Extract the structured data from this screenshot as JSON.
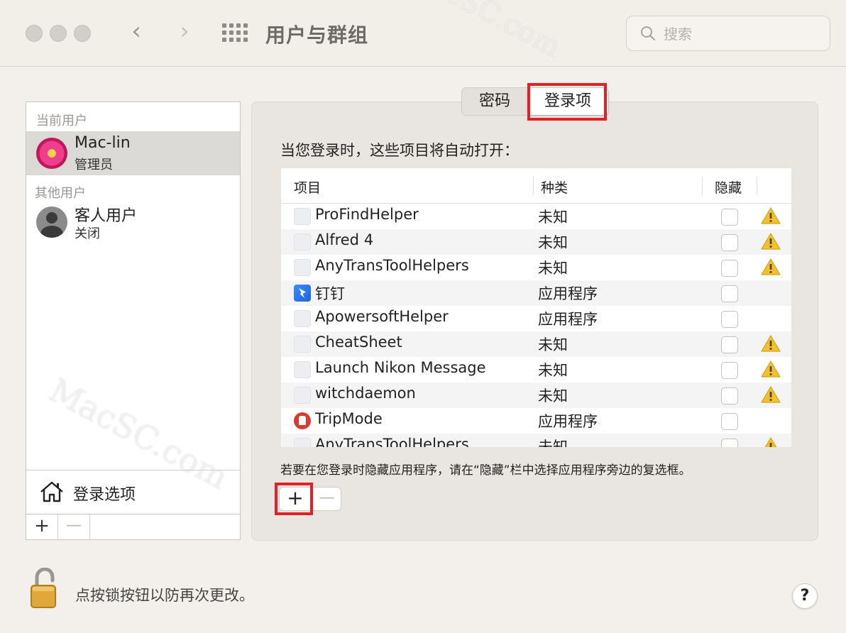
{
  "window": {
    "title": "用户与群组",
    "search_placeholder": "搜索",
    "back_label": "‹",
    "forward_label": "›"
  },
  "watermark": "MacSC.com",
  "users_panel": {
    "current_section": "当前用户",
    "current_user": {
      "name": "Mac-lin",
      "role": "管理员",
      "avatar": "flower-avatar"
    },
    "other_section": "其他用户",
    "other_user": {
      "name": "客人用户",
      "role": "关闭",
      "avatar": "guest-avatar"
    },
    "login_options_label": "登录选项",
    "add_label": "+",
    "remove_label": "—"
  },
  "tabs": [
    {
      "label": "密码",
      "active": false
    },
    {
      "label": "登录项",
      "active": true
    }
  ],
  "login_items": {
    "intro": "当您登录时，这些项目将自动打开：",
    "columns": {
      "item": "项目",
      "kind": "种类",
      "hide": "隐藏"
    },
    "rows": [
      {
        "name": "ProFindHelper",
        "kind": "未知",
        "hidden": false,
        "warning": true,
        "icon": "generic-app-icon"
      },
      {
        "name": "Alfred 4",
        "kind": "未知",
        "hidden": false,
        "warning": true,
        "icon": "generic-app-icon"
      },
      {
        "name": "AnyTransToolHelpers",
        "kind": "未知",
        "hidden": false,
        "warning": true,
        "icon": "generic-app-icon"
      },
      {
        "name": "钉钉",
        "kind": "应用程序",
        "hidden": false,
        "warning": false,
        "icon": "dingtalk-icon"
      },
      {
        "name": "ApowersoftHelper",
        "kind": "应用程序",
        "hidden": false,
        "warning": false,
        "icon": "generic-app-icon"
      },
      {
        "name": "CheatSheet",
        "kind": "未知",
        "hidden": false,
        "warning": true,
        "icon": "generic-app-icon"
      },
      {
        "name": "Launch Nikon Message",
        "kind": "未知",
        "hidden": false,
        "warning": true,
        "icon": "generic-app-icon"
      },
      {
        "name": "witchdaemon",
        "kind": "未知",
        "hidden": false,
        "warning": true,
        "icon": "generic-app-icon"
      },
      {
        "name": "TripMode",
        "kind": "应用程序",
        "hidden": false,
        "warning": false,
        "icon": "tripmode-icon"
      },
      {
        "name": "AnyTransToolHelpers",
        "kind": "未知",
        "hidden": false,
        "warning": true,
        "icon": "generic-app-icon"
      }
    ],
    "hint": "若要在您登录时隐藏应用程序，请在“隐藏”栏中选择应用程序旁边的复选框。",
    "add_label": "+",
    "remove_label": "—"
  },
  "footer": {
    "lock_text": "点按锁按钮以防再次更改。",
    "help_label": "?"
  },
  "colors": {
    "highlight": "#e32028",
    "warning": "#f2c12e",
    "window_bg": "#f3f0eb"
  }
}
